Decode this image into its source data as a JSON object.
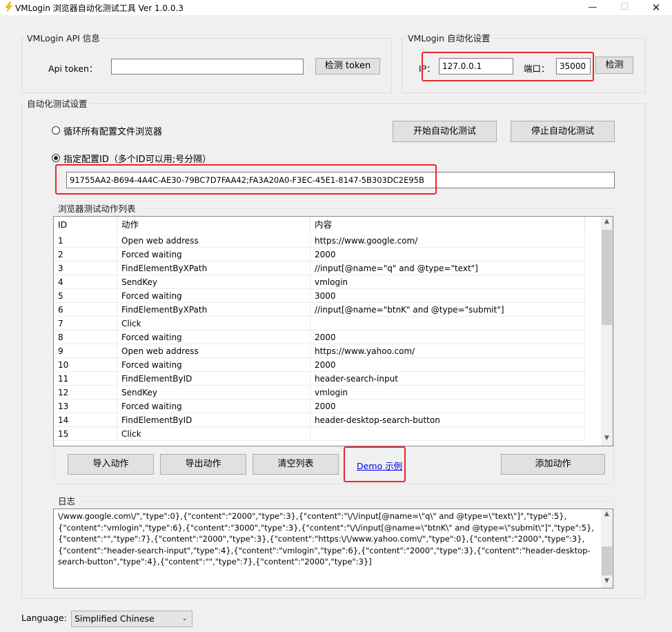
{
  "window": {
    "title": "VMLogin 浏览器自动化测试工具 Ver 1.0.0.3",
    "minimize_icon": "minimize-icon",
    "maximize_icon": "maximize-icon",
    "close_icon": "close-icon"
  },
  "api_group": {
    "legend": "VMLogin API 信息",
    "token_label": "Api token：",
    "token_value": "",
    "check_button": "检测 token"
  },
  "auto_group": {
    "legend": "VMLogin 自动化设置",
    "ip_label": "IP：",
    "ip_value": "127.0.0.1",
    "port_label": "端口：",
    "port_value": "35000",
    "check_button": "检测"
  },
  "test_group": {
    "legend": "自动化测试设置",
    "radio_all_label": "循环所有配置文件浏览器",
    "radio_all_checked": false,
    "radio_specified_label": "指定配置ID（多个ID可以用;号分隔）",
    "radio_specified_checked": true,
    "start_button": "开始自动化测试",
    "stop_button": "停止自动化测试",
    "profile_ids": "91755AA2-B694-4A4C-AE30-79BC7D7FAA42;FA3A20A0-F3EC-45E1-8147-5B303DC2E95B"
  },
  "actions_group": {
    "legend": "浏览器测试动作列表",
    "columns": [
      "ID",
      "动作",
      "内容"
    ],
    "rows": [
      [
        "1",
        "Open web address",
        "https://www.google.com/"
      ],
      [
        "2",
        "Forced waiting",
        "2000"
      ],
      [
        "3",
        "FindElementByXPath",
        "//input[@name=\"q\" and @type=\"text\"]"
      ],
      [
        "4",
        "SendKey",
        "vmlogin"
      ],
      [
        "5",
        "Forced waiting",
        "3000"
      ],
      [
        "6",
        "FindElementByXPath",
        "//input[@name=\"btnK\" and @type=\"submit\"]"
      ],
      [
        "7",
        "Click",
        ""
      ],
      [
        "8",
        "Forced waiting",
        "2000"
      ],
      [
        "9",
        "Open web address",
        "https://www.yahoo.com/"
      ],
      [
        "10",
        "Forced waiting",
        "2000"
      ],
      [
        "11",
        "FindElementByID",
        "header-search-input"
      ],
      [
        "12",
        "SendKey",
        "vmlogin"
      ],
      [
        "13",
        "Forced waiting",
        "2000"
      ],
      [
        "14",
        "FindElementByID",
        "header-desktop-search-button"
      ],
      [
        "15",
        "Click",
        ""
      ]
    ],
    "import_button": "导入动作",
    "export_button": "导出动作",
    "clear_button": "清空列表",
    "demo_link": "Demo 示例",
    "add_button": "添加动作"
  },
  "log_group": {
    "legend": "日志",
    "lines": [
      "\\/www.google.com\\/\",\"type\":0},{\"content\":\"2000\",\"type\":3},{\"content\":\"\\/\\/input[@name=\\\"q\\\" and @type=\\\"text\\\"]\",\"type\":5},",
      "{\"content\":\"vmlogin\",\"type\":6},{\"content\":\"3000\",\"type\":3},{\"content\":\"\\/\\/input[@name=\\\"btnK\\\" and @type=\\\"submit\\\"]\",\"type\":5},",
      "{\"content\":\"\",\"type\":7},{\"content\":\"2000\",\"type\":3},{\"content\":\"https:\\/\\/www.yahoo.com\\/\",\"type\":0},{\"content\":\"2000\",\"type\":3},",
      "{\"content\":\"header-search-input\",\"type\":4},{\"content\":\"vmlogin\",\"type\":6},{\"content\":\"2000\",\"type\":3},{\"content\":\"header-desktop-",
      "search-button\",\"type\":4},{\"content\":\"\",\"type\":7},{\"content\":\"2000\",\"type\":3}]"
    ]
  },
  "language": {
    "label": "Language:",
    "selected": "Simplified Chinese"
  },
  "colors": {
    "highlight": "#e8262a",
    "window_bg": "#f0f0f0",
    "link": "#0000ee"
  }
}
